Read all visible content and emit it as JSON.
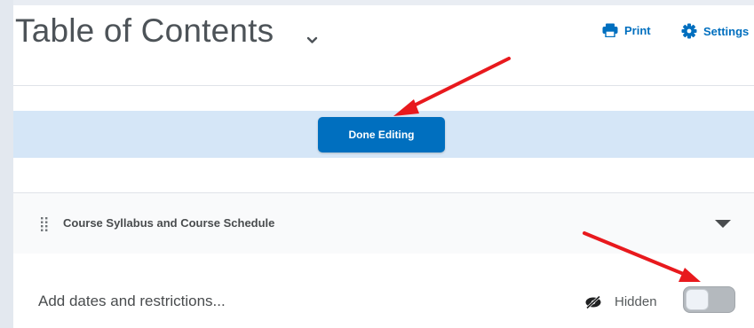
{
  "header": {
    "title": "Table of Contents",
    "print_label": "Print",
    "settings_label": "Settings"
  },
  "edit_bar": {
    "done_label": "Done Editing"
  },
  "module": {
    "title": "Course Syllabus and Course Schedule"
  },
  "restrictions": {
    "add_label": "Add dates and restrictions...",
    "visibility_label": "Hidden",
    "visible": false
  },
  "colors": {
    "accent": "#006fbf",
    "edit_band": "#d5e6f7",
    "annotation_arrow": "#e8191d"
  },
  "icons": {
    "print": "printer-icon",
    "settings": "gear-icon",
    "hidden": "eye-slash-icon",
    "drag": "drag-handle-icon",
    "expand": "caret-down-icon",
    "title_menu": "chevron-down-icon"
  }
}
